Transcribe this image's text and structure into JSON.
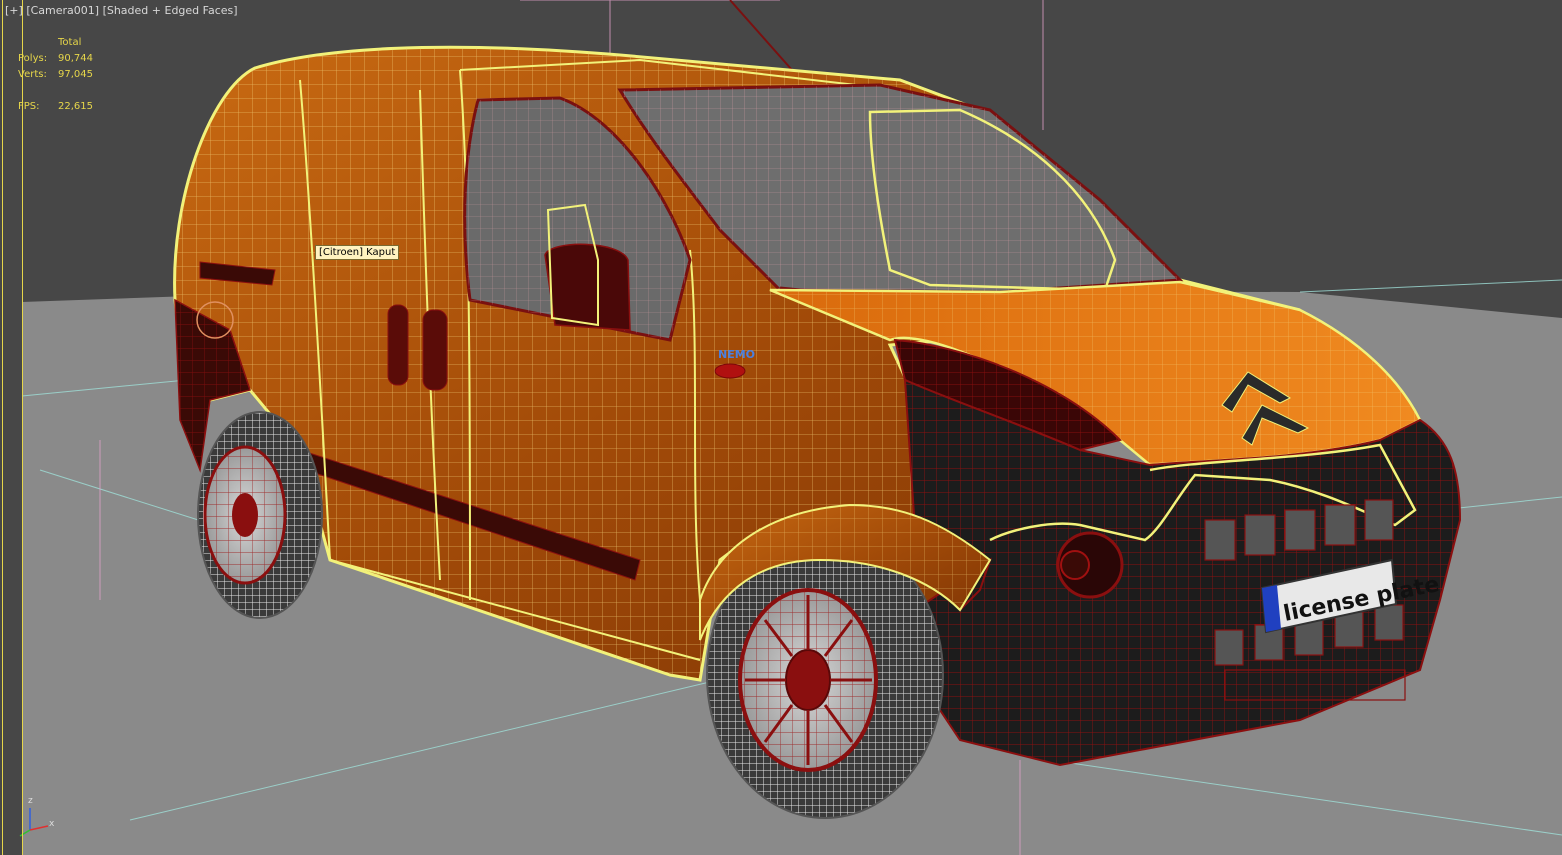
{
  "viewport": {
    "plus_label": "[+]",
    "camera_label": "[Camera001]",
    "shading_label": "[Shaded + Edged Faces]"
  },
  "stats": {
    "header": "Total",
    "polys_label": "Polys:",
    "polys_value": "90,744",
    "verts_label": "Verts:",
    "verts_value": "97,045",
    "fps_label": "FPS:",
    "fps_value": "22,615"
  },
  "tooltip": {
    "text": "[Citroen] Kaput"
  },
  "model": {
    "license_plate_text": "license plate",
    "badge_text": "NEMO"
  },
  "axis": {
    "z": "z",
    "x": "x"
  },
  "colors": {
    "background": "#474747",
    "floor": "#8a8a8a",
    "body_orange": "#e07a10",
    "selection_yellow": "#f2f27a",
    "wire_red": "#8a0f0f",
    "stats_yellow": "#e6d64a"
  }
}
